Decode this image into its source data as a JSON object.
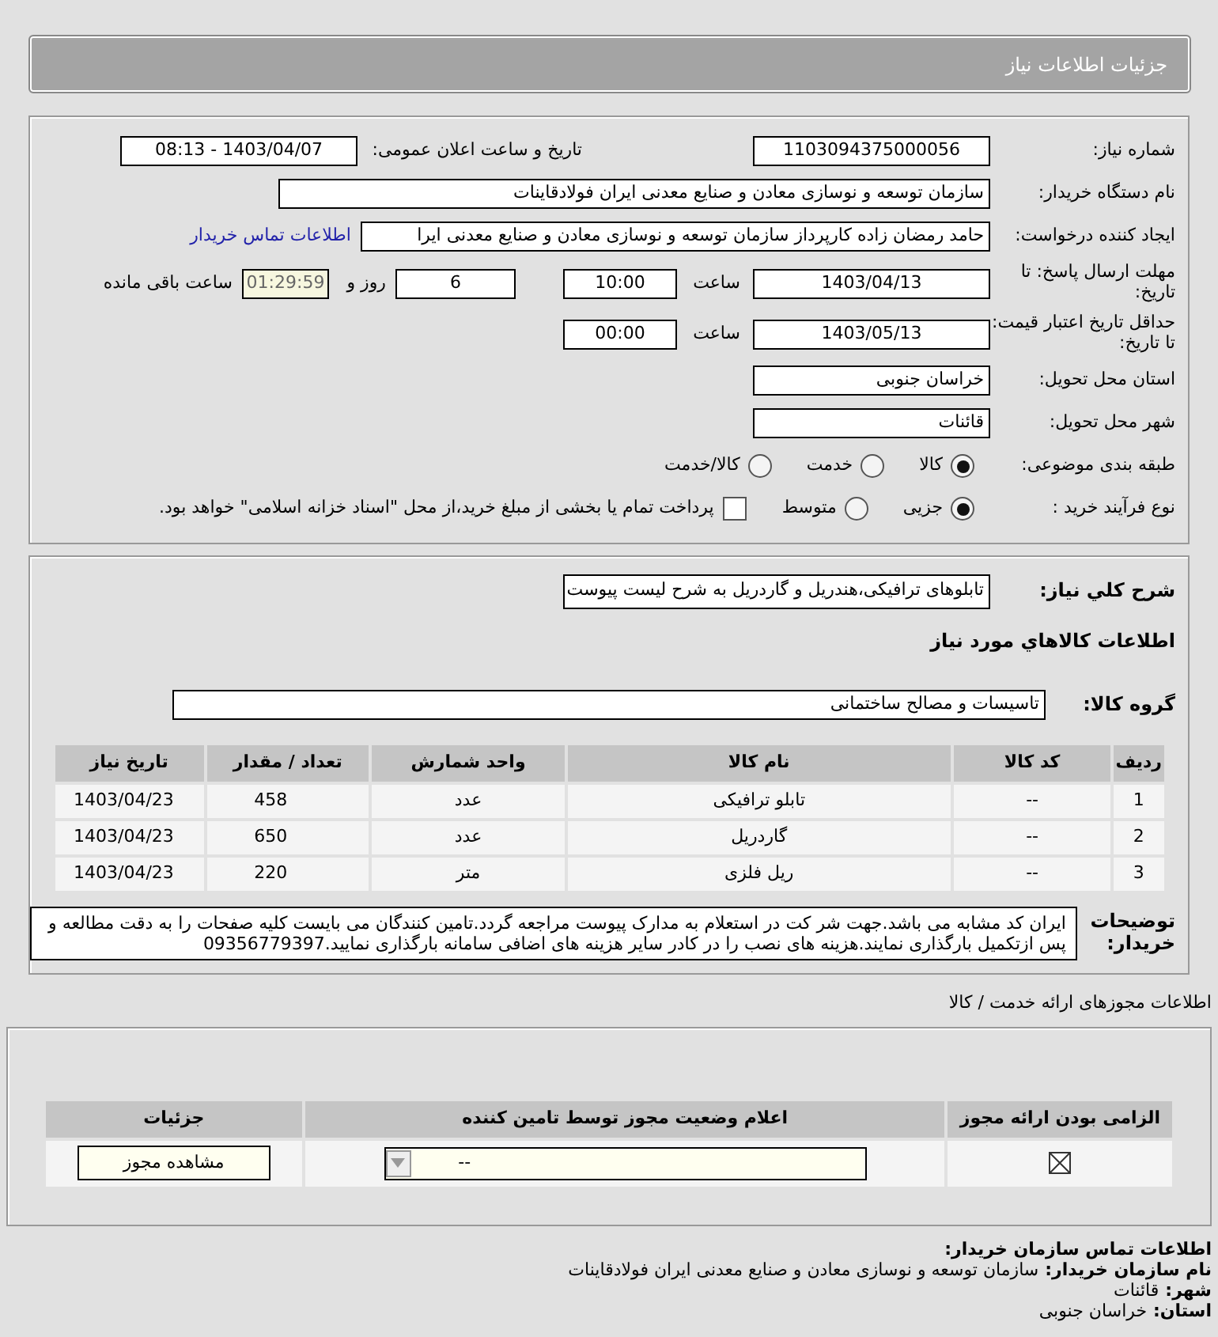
{
  "header": {
    "title": "جزئیات اطلاعات نیاز"
  },
  "need_number": {
    "label": "شماره نیاز:",
    "value": "1103094375000056"
  },
  "announce": {
    "label": "تاریخ و ساعت اعلان عمومی:",
    "value": "1403/04/07 - 08:13"
  },
  "buyer_org": {
    "label": "نام دستگاه خریدار:",
    "value": "سازمان توسعه و نوسازی معادن و صنایع معدنی ایران فولادقاینات"
  },
  "requester": {
    "label": "ایجاد کننده درخواست:",
    "value": "حامد  رمضان زاده  کارپرداز  سازمان توسعه و نوسازی معادن و صنایع معدنی ایرا",
    "link": "اطلاعات تماس خریدار"
  },
  "deadline": {
    "label": "مهلت ارسال پاسخ: تا تاریخ:",
    "date": "1403/04/13",
    "time_label": "ساعت",
    "time": "10:00",
    "days": "6",
    "days_label": "روز و",
    "remaining": "01:29:59",
    "remaining_label": "ساعت باقی مانده"
  },
  "validity": {
    "label": "حداقل تاریخ اعتبار قیمت: تا تاریخ:",
    "date": "1403/05/13",
    "time_label": "ساعت",
    "time": "00:00"
  },
  "province": {
    "label": "استان محل تحویل:",
    "value": "خراسان جنوبی"
  },
  "city": {
    "label": "شهر محل تحویل:",
    "value": "قائنات"
  },
  "category": {
    "label": "طبقه بندی موضوعی:",
    "options": [
      {
        "label": "کالا",
        "selected": true
      },
      {
        "label": "خدمت",
        "selected": false
      },
      {
        "label": "کالا/خدمت",
        "selected": false
      }
    ]
  },
  "process": {
    "label": "نوع فرآیند خرید :",
    "options": [
      {
        "label": "جزیی",
        "selected": true
      },
      {
        "label": "متوسط",
        "selected": false
      }
    ],
    "payment": {
      "label": "پرداخت تمام یا بخشی از مبلغ خرید،از محل \"اسناد خزانه اسلامی\" خواهد بود.",
      "checked": false
    }
  },
  "summary": {
    "label": "شرح کلي نياز:",
    "value": "تابلوهای ترافیکی،هندریل و گاردریل به شرح لیست پیوست"
  },
  "goods_heading": "اطلاعات کالاهاي مورد نياز",
  "goods_group": {
    "label": "گروه کالا:",
    "value": "تاسیسات و مصالح ساختمانی"
  },
  "goods_table": {
    "columns": [
      "ردیف",
      "کد کالا",
      "نام کالا",
      "واحد شمارش",
      "تعداد / مقدار",
      "تاریخ نیاز"
    ],
    "rows": [
      [
        "1",
        "--",
        "تابلو ترافیکی",
        "عدد",
        "458",
        "1403/04/23"
      ],
      [
        "2",
        "--",
        "گاردریل",
        "عدد",
        "650",
        "1403/04/23"
      ],
      [
        "3",
        "--",
        "ریل فلزی",
        "متر",
        "220",
        "1403/04/23"
      ]
    ]
  },
  "buyer_notes": {
    "label": "توضیحات خریدار:",
    "text": "ایران کد مشابه می باشد.جهت شر کت در استعلام به مدارک پیوست مراجعه گردد.تامین کنندگان می بایست کلیه صفحات را به دقت مطالعه و پس ازتکمیل بارگذاری نمایند.هزینه های نصب را در کادر سایر هزینه های اضافی سامانه بارگذاری نمایید.09356779397"
  },
  "permits": {
    "title": "اطلاعات مجوزهای ارائه خدمت / کالا",
    "columns": [
      "الزامی بودن ارائه مجوز",
      "اعلام وضعیت مجوز توسط تامین کننده",
      "جزئیات"
    ],
    "rows": [
      {
        "required": true,
        "status": "--",
        "button": "مشاهده مجوز"
      }
    ]
  },
  "contact": {
    "title": "اطلاعات تماس سازمان خریدار:",
    "items": [
      {
        "label": "نام سازمان خریدار:",
        "value": "سازمان توسعه و نوسازی معادن و صنایع معدنی ایران فولادقاینات"
      },
      {
        "label": "شهر:",
        "value": "قائنات"
      },
      {
        "label": "استان:",
        "value": "خراسان جنوبی"
      }
    ]
  }
}
